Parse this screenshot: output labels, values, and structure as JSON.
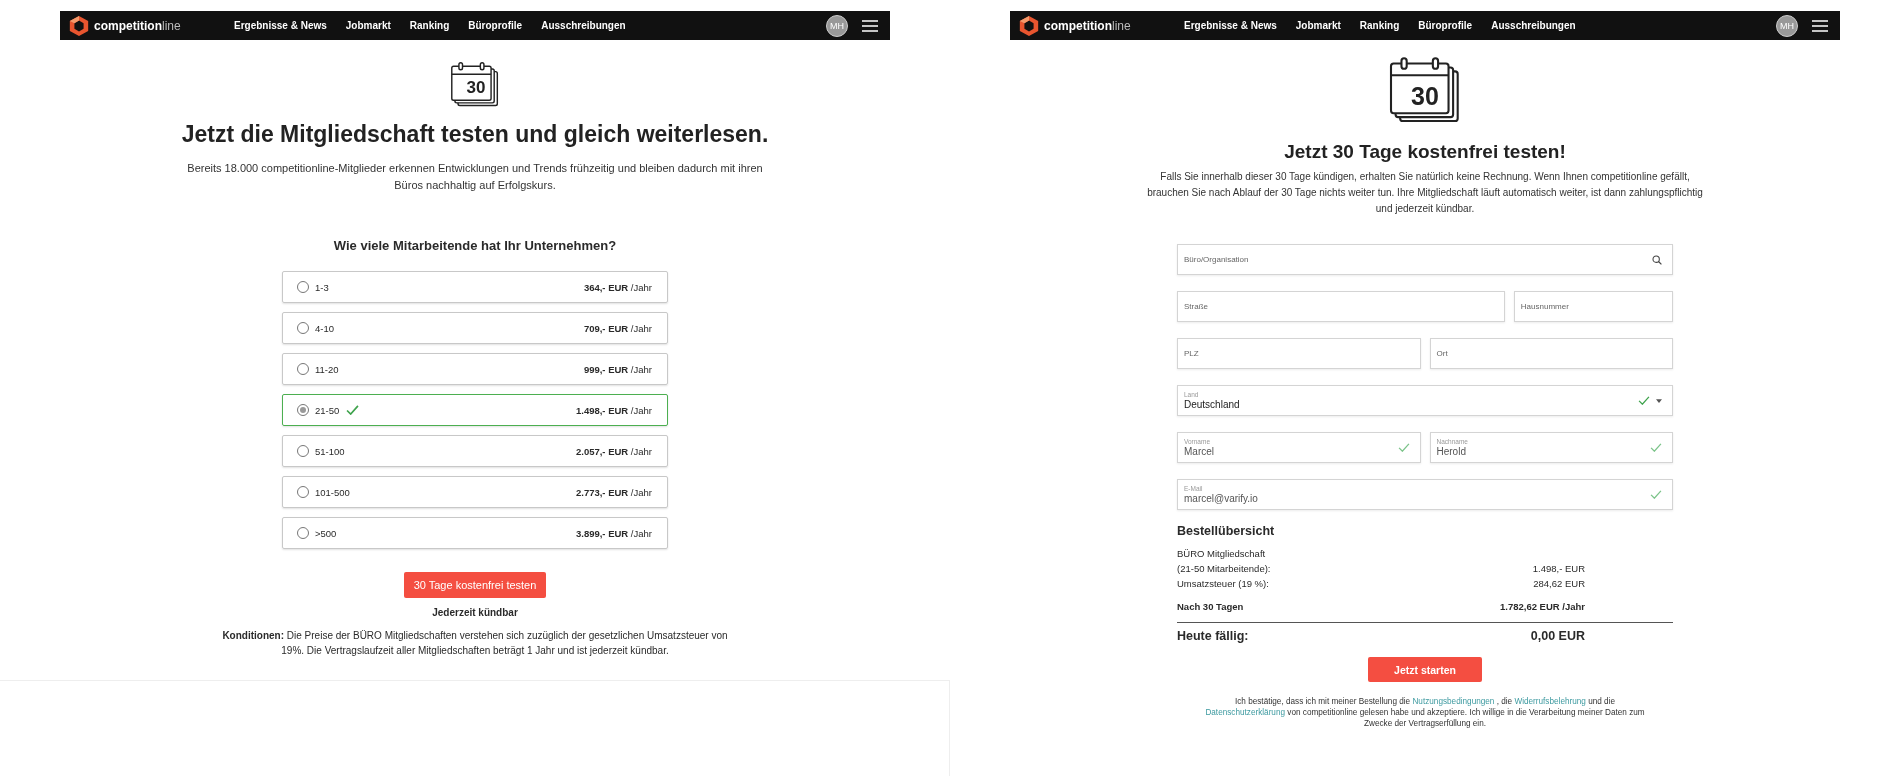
{
  "left_page": {
    "nav": {
      "logo": "**competition**line",
      "links": [
        "Ergebnisse & News",
        "Jobmarkt",
        "Ranking",
        "Büroprofile",
        "Ausschreibungen"
      ],
      "avatar": "MH"
    },
    "day_number": "30",
    "title": "Jetzt die Mitgliedschaft testen und gleich weiterlesen.",
    "intro": "Bereits 18.000 competitionline-Mitglieder erkennen Entwicklungen und Trends frühzeitig und bleiben dadurch mit ihren Büros nachhaltig auf Erfolgskurs.",
    "question": "Wie viele Mitarbeitende hat Ihr Unternehmen?",
    "options": [
      {
        "range": "1-3",
        "price": "364,- EUR",
        "unit": "/Jahr",
        "selected": false
      },
      {
        "range": "4-10",
        "price": "709,- EUR",
        "unit": "/Jahr",
        "selected": false
      },
      {
        "range": "11-20",
        "price": "999,- EUR",
        "unit": "/Jahr",
        "selected": false
      },
      {
        "range": "21-50",
        "price": "1.498,- EUR",
        "unit": "/Jahr",
        "selected": true
      },
      {
        "range": "51-100",
        "price": "2.057,- EUR",
        "unit": "/Jahr",
        "selected": false
      },
      {
        "range": "101-500",
        "price": "2.773,- EUR",
        "unit": "/Jahr",
        "selected": false
      },
      {
        "range": ">500",
        "price": "3.899,- EUR",
        "unit": "/Jahr",
        "selected": false
      }
    ],
    "cta": "30 Tage kostenfrei testen",
    "note": "Jederzeit kündbar",
    "conditions": "**Konditionen:** Die Preise der BÜRO Mitgliedschaften verstehen sich zuzüglich der gesetzlichen Umsatzsteuer von 19%. Die Vertragslaufzeit aller Mitgliedschaften beträgt 1 Jahr und ist jederzeit kündbar."
  },
  "right_page": {
    "nav": {
      "logo": "**competition**line",
      "links": [
        "Ergebnisse & News",
        "Jobmarkt",
        "Ranking",
        "Büroprofile",
        "Ausschreibungen"
      ],
      "avatar": "MH"
    },
    "day_number": "30",
    "title": "Jetzt 30 Tage kostenfrei testen!",
    "intro": "Falls Sie innerhalb dieser 30 Tage kündigen, erhalten Sie natürlich keine Rechnung. Wenn Ihnen competitionline gefällt, brauchen Sie nach Ablauf der 30 Tage nichts weiter tun. Ihre Mitgliedschaft läuft automatisch weiter, ist dann zahlungspflichtig und jederzeit kündbar.",
    "form_rows": [
      {
        "kind": "single",
        "fields": [
          {
            "kind": "search",
            "placeholder": "Büro/Organisation",
            "valid": false
          }
        ]
      },
      {
        "kind": "split",
        "fields": [
          {
            "kind": "text",
            "placeholder": "Straße",
            "valid": false
          },
          {
            "kind": "text",
            "placeholder": "Hausnummer",
            "valid": false
          }
        ]
      },
      {
        "kind": "pair",
        "fields": [
          {
            "kind": "text",
            "placeholder": "PLZ",
            "valid": false
          },
          {
            "kind": "text",
            "placeholder": "Ort",
            "valid": false
          }
        ]
      },
      {
        "kind": "single",
        "fields": [
          {
            "kind": "select",
            "label": "Land",
            "value": "Deutschland",
            "valid": true
          }
        ]
      },
      {
        "kind": "pair",
        "fields": [
          {
            "kind": "text",
            "label": "Vorname",
            "value": "Marcel",
            "valid": true
          },
          {
            "kind": "text",
            "label": "Nachname",
            "value": "Herold",
            "valid": true
          }
        ]
      },
      {
        "kind": "single",
        "fields": [
          {
            "kind": "text",
            "label": "E-Mail",
            "value": "marcel@varify.io",
            "valid": true
          }
        ]
      }
    ],
    "summary": {
      "title": "Bestellübersicht",
      "lines": [
        {
          "kind": "item",
          "label": "BÜRO Mitgliedschaft"
        },
        {
          "kind": "item",
          "label": "(21-50 Mitarbeitende):",
          "amount": "1.498,- EUR"
        },
        {
          "kind": "item",
          "label": "Umsatzsteuer (19 %):",
          "amount": "284,62 EUR"
        },
        {
          "kind": "total",
          "label": "Nach 30 Tagen",
          "amount": "1.782,62 EUR /Jahr"
        }
      ],
      "due_label": "Heute fällig:",
      "due_amount": "0,00 EUR"
    },
    "cta": "Jetzt starten",
    "terms": [
      {
        "kind": "text",
        "text": "Ich bestätige, dass ich mit meiner Bestellung die "
      },
      {
        "kind": "link",
        "text": "Nutzungsbedingungen"
      },
      {
        "kind": "text",
        "text": " , die "
      },
      {
        "kind": "link",
        "text": "Widerrufsbelehrung"
      },
      {
        "kind": "text",
        "text": " und die "
      },
      {
        "kind": "link",
        "text": "Datenschutzerklärung"
      },
      {
        "kind": "text",
        "text": " von competitionline gelesen habe und akzeptiere. Ich willige in die Verarbeitung meiner Daten zum Zwecke der Vertragserfüllung ein."
      }
    ]
  }
}
